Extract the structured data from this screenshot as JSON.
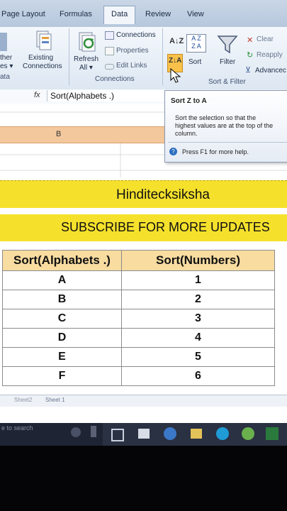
{
  "ribbon": {
    "tabs": [
      {
        "label": "Page Layout"
      },
      {
        "label": "Formulas"
      },
      {
        "label": "Data"
      },
      {
        "label": "Review"
      },
      {
        "label": "View"
      }
    ],
    "other_sources": [
      "ther",
      "es ▾"
    ],
    "existing_connections": [
      "Existing",
      "Connections"
    ],
    "refresh_all": [
      "Refresh",
      "All ▾"
    ],
    "connections_group": {
      "connections": "Connections",
      "properties": "Properties",
      "edit_links": "Edit Links",
      "label": "Connections"
    },
    "sort_filter": {
      "sort": "Sort",
      "filter": "Filter",
      "clear": "Clear",
      "reapply": "Reapply",
      "advanced": "Advancec",
      "label": "Sort & Filter",
      "sort_az_glyph": "A↓Z",
      "sort_za_glyph": "Z↓A"
    },
    "get_external_label": "ata"
  },
  "formula_bar": {
    "fx": "fx",
    "value": "Sort(Alphabets .)"
  },
  "sheet": {
    "column_letter": "B",
    "title_banner": "Hinditecksiksha",
    "subtitle_banner": "SUBSCRIBE FOR MORE UPDATES",
    "table": {
      "headers": [
        "Sort(Alphabets .)",
        "Sort(Numbers)"
      ],
      "rows": [
        [
          "A",
          "1"
        ],
        [
          "B",
          "2"
        ],
        [
          "C",
          "3"
        ],
        [
          "D",
          "4"
        ],
        [
          "E",
          "5"
        ],
        [
          "F",
          "6"
        ]
      ]
    },
    "sheet_tabs": [
      "Sheet2",
      "Sheet 1"
    ]
  },
  "tooltip": {
    "title": "Sort Z to A",
    "body": [
      "Sort the selection so that the",
      "highest values are at the top of the",
      "column."
    ],
    "help": "Press F1 for more help."
  },
  "taskbar": {
    "search_placeholder": "e to search"
  }
}
